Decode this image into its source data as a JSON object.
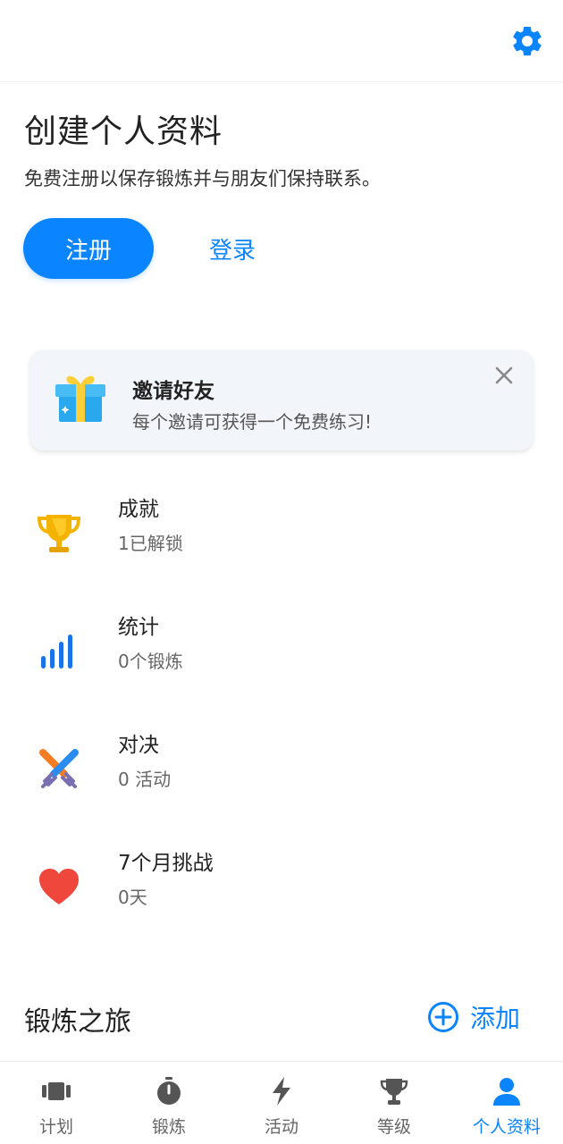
{
  "header": {
    "settings_icon": "gear-icon"
  },
  "profile": {
    "title": "创建个人资料",
    "subtitle": "免费注册以保存锻炼并与朋友们保持联系。",
    "register_label": "注册",
    "login_label": "登录"
  },
  "invite": {
    "title": "邀请好友",
    "subtitle": "每个邀请可获得一个免费练习!",
    "icon": "gift-icon",
    "close_icon": "close-icon"
  },
  "stats": [
    {
      "label": "成就",
      "value": "1已解锁",
      "icon": "trophy-icon"
    },
    {
      "label": "统计",
      "value": "0个锻炼",
      "icon": "bar-chart-icon"
    },
    {
      "label": "对决",
      "value": "0 活动",
      "icon": "crossed-swords-icon"
    },
    {
      "label": "7个月挑战",
      "value": "0天",
      "icon": "heart-icon"
    }
  ],
  "journey": {
    "title": "锻炼之旅",
    "add_label": "添加"
  },
  "nav": {
    "items": [
      {
        "label": "计划",
        "icon": "plan-icon"
      },
      {
        "label": "锻炼",
        "icon": "stopwatch-icon"
      },
      {
        "label": "活动",
        "icon": "lightning-icon"
      },
      {
        "label": "等级",
        "icon": "trophy-icon"
      },
      {
        "label": "个人资料",
        "icon": "person-icon"
      }
    ],
    "active_index": 4
  },
  "colors": {
    "accent": "#0a84ff",
    "gold": "#f5b301",
    "heart": "#f0473c",
    "card": "#f2f6fb"
  }
}
